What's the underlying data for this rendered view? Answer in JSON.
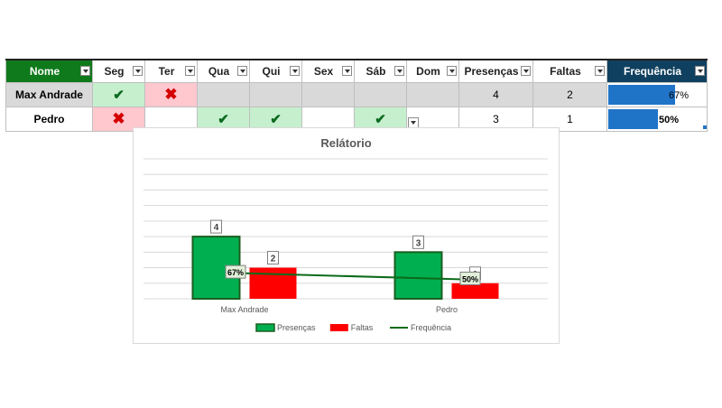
{
  "table": {
    "headers": [
      "Nome",
      "Seg",
      "Ter",
      "Qua",
      "Qui",
      "Sex",
      "Sáb",
      "Dom",
      "Presenças",
      "Faltas",
      "Frequência"
    ],
    "rows": [
      {
        "name": "Max Andrade",
        "days": [
          "check",
          "cross",
          "",
          "",
          "",
          "",
          ""
        ],
        "presencas": "4",
        "faltas": "2",
        "frequencia": "67%",
        "freq_value": 0.67
      },
      {
        "name": "Pedro",
        "days": [
          "cross",
          "",
          "check",
          "check",
          "",
          "check",
          ""
        ],
        "presencas": "3",
        "faltas": "1",
        "frequencia": "50%",
        "freq_value": 0.5
      }
    ],
    "icons": {
      "check": "✔",
      "cross": "✖"
    }
  },
  "chart_data": {
    "type": "bar",
    "title": "Relátorio",
    "categories": [
      "Max Andrade",
      "Pedro"
    ],
    "series": [
      {
        "name": "Presenças",
        "type": "bar",
        "values": [
          4,
          3
        ],
        "color": "#00b050",
        "border": "#1a5e20"
      },
      {
        "name": "Faltas",
        "type": "bar",
        "values": [
          2,
          1
        ],
        "color": "#ff0000"
      },
      {
        "name": "Frequência",
        "type": "line",
        "values": [
          0.67,
          0.5
        ],
        "labels": [
          "67%",
          "50%"
        ],
        "color": "#0b6b1a"
      }
    ],
    "ylim": [
      0,
      9
    ],
    "grid": true,
    "legend": "bottom"
  }
}
